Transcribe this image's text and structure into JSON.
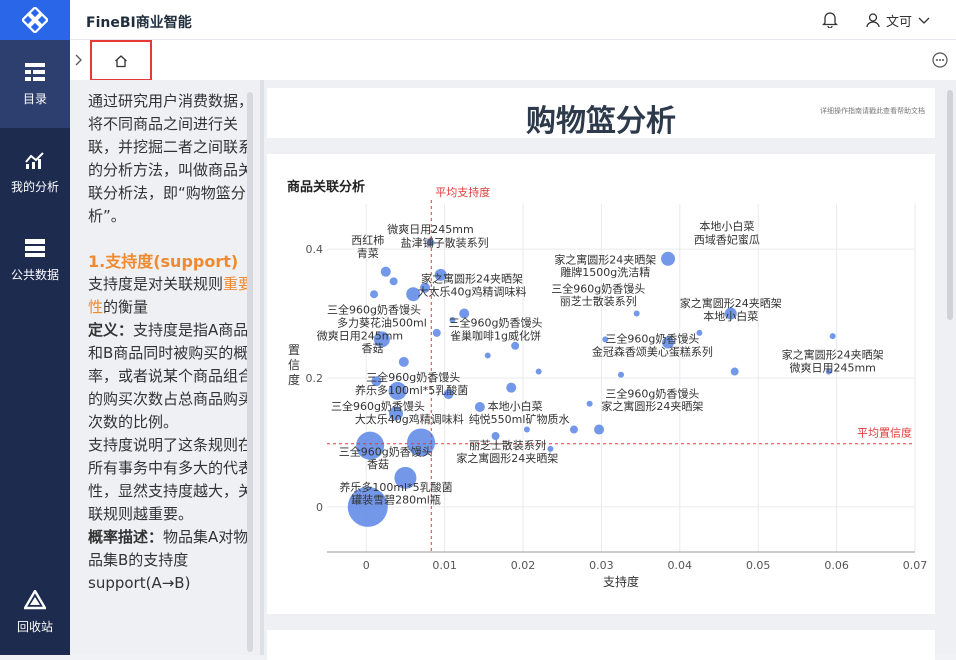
{
  "app": {
    "title": "FineBI商业智能",
    "user_name": "文可"
  },
  "nav": [
    {
      "id": "catalog",
      "label": "目录",
      "icon": "catalog-icon"
    },
    {
      "id": "analysis",
      "label": "我的分析",
      "icon": "analysis-icon"
    },
    {
      "id": "public",
      "label": "公共数据",
      "icon": "database-icon"
    }
  ],
  "nav_bottom": {
    "label": "回收站",
    "icon": "recycle-icon"
  },
  "tabs": {
    "home_icon": "home-icon"
  },
  "left_text": {
    "intro": "通过研究用户消费数据，将不同商品之间进行关联，并挖掘二者之间联系的分析方法，叫做商品关联分析法，即“购物篮分析”。",
    "section_title": "1.支持度(support)",
    "p1_a": "支持度是对关联规则",
    "p1_em": "重要性",
    "p1_b": "的衡量",
    "p2_label": "定义：",
    "p2_text": "支持度是指A商品和B商品同时被购买的概率，或者说某个商品组合的购买次数占总商品购买次数的比例。",
    "p3": "支持度说明了这条规则在所有事务中有多大的代表性，显然支持度越大，关联规则越重要。",
    "p4_label": "概率描述：",
    "p4_text": "物品集A对物品集B的支持度support(A→B)"
  },
  "dashboard": {
    "title": "购物篮分析",
    "help_note": "详细操作指南请戳此查看帮助文档"
  },
  "chart_data": {
    "type": "scatter",
    "title": "商品关联分析",
    "xlabel": "支持度",
    "ylabel": "置信度",
    "xlim": [
      -0.005,
      0.07
    ],
    "ylim": [
      -0.07,
      0.47
    ],
    "x_ticks": [
      "0",
      "0.01",
      "0.02",
      "0.03",
      "0.04",
      "0.05",
      "0.06",
      "0.07"
    ],
    "x_tick_values": [
      0,
      0.01,
      0.02,
      0.03,
      0.04,
      0.05,
      0.06,
      0.07
    ],
    "y_ticks": [
      "0",
      "0.2",
      "0.4"
    ],
    "y_tick_values": [
      0,
      0.2,
      0.4
    ],
    "avg_support": {
      "label": "平均支持度",
      "value": 0.0083
    },
    "avg_confidence": {
      "label": "平均置信度",
      "value": 0.098
    },
    "color": "#5b86e5",
    "line_color": "#e03b3b",
    "points": [
      {
        "x": 0.0002,
        "y": 0.0,
        "r": 20
      },
      {
        "x": 0.0005,
        "y": 0.095,
        "r": 14
      },
      {
        "x": 0.007,
        "y": 0.1,
        "r": 14
      },
      {
        "x": 0.005,
        "y": 0.045,
        "r": 11
      },
      {
        "x": 0.004,
        "y": 0.18,
        "r": 9
      },
      {
        "x": 0.002,
        "y": 0.26,
        "r": 8
      },
      {
        "x": 0.006,
        "y": 0.33,
        "r": 7
      },
      {
        "x": 0.0095,
        "y": 0.36,
        "r": 6
      },
      {
        "x": 0.0038,
        "y": 0.145,
        "r": 7
      },
      {
        "x": 0.0105,
        "y": 0.175,
        "r": 5
      },
      {
        "x": 0.0125,
        "y": 0.3,
        "r": 5
      },
      {
        "x": 0.0145,
        "y": 0.155,
        "r": 5
      },
      {
        "x": 0.0185,
        "y": 0.185,
        "r": 5
      },
      {
        "x": 0.0165,
        "y": 0.11,
        "r": 4
      },
      {
        "x": 0.019,
        "y": 0.25,
        "r": 4
      },
      {
        "x": 0.0025,
        "y": 0.365,
        "r": 5
      },
      {
        "x": 0.001,
        "y": 0.33,
        "r": 4
      },
      {
        "x": 0.0035,
        "y": 0.35,
        "r": 4
      },
      {
        "x": 0.0075,
        "y": 0.34,
        "r": 5
      },
      {
        "x": 0.0048,
        "y": 0.225,
        "r": 5
      },
      {
        "x": 0.009,
        "y": 0.27,
        "r": 4
      },
      {
        "x": 0.011,
        "y": 0.29,
        "r": 3
      },
      {
        "x": 0.0155,
        "y": 0.235,
        "r": 3
      },
      {
        "x": 0.0205,
        "y": 0.12,
        "r": 3
      },
      {
        "x": 0.022,
        "y": 0.21,
        "r": 3
      },
      {
        "x": 0.0265,
        "y": 0.12,
        "r": 4
      },
      {
        "x": 0.0285,
        "y": 0.16,
        "r": 3
      },
      {
        "x": 0.0297,
        "y": 0.12,
        "r": 5
      },
      {
        "x": 0.0305,
        "y": 0.26,
        "r": 3
      },
      {
        "x": 0.0385,
        "y": 0.385,
        "r": 7
      },
      {
        "x": 0.0385,
        "y": 0.255,
        "r": 6
      },
      {
        "x": 0.0465,
        "y": 0.3,
        "r": 6
      },
      {
        "x": 0.047,
        "y": 0.21,
        "r": 4
      },
      {
        "x": 0.0595,
        "y": 0.265,
        "r": 3
      },
      {
        "x": 0.059,
        "y": 0.21,
        "r": 3
      },
      {
        "x": 0.0325,
        "y": 0.205,
        "r": 3
      },
      {
        "x": 0.0425,
        "y": 0.27,
        "r": 3
      },
      {
        "x": 0.0082,
        "y": 0.41,
        "r": 4
      },
      {
        "x": 0.0345,
        "y": 0.3,
        "r": 3
      },
      {
        "x": 0.0235,
        "y": 0.09,
        "r": 3
      },
      {
        "x": 0.0013,
        "y": 0.195,
        "r": 5
      }
    ],
    "annotations": [
      {
        "text": "西红柿",
        "x": 0.0002,
        "y": 0.408
      },
      {
        "text": "青菜",
        "x": 0.0002,
        "y": 0.388
      },
      {
        "text": "微爽日用245mm",
        "x": 0.0082,
        "y": 0.425
      },
      {
        "text": "盐津铺子散装系列",
        "x": 0.01,
        "y": 0.404
      },
      {
        "text": "本地小白菜",
        "x": 0.046,
        "y": 0.43
      },
      {
        "text": "西域香妃蜜瓜",
        "x": 0.046,
        "y": 0.409
      },
      {
        "text": "家之寓圆形24夹晒架",
        "x": 0.0135,
        "y": 0.348
      },
      {
        "text": "大太乐40g鸡精调味料",
        "x": 0.0135,
        "y": 0.328
      },
      {
        "text": "家之寓圆形24夹晒架",
        "x": 0.0305,
        "y": 0.378
      },
      {
        "text": "雕牌1500g洗洁精",
        "x": 0.0305,
        "y": 0.358
      },
      {
        "text": "三全960g奶香馒头",
        "x": 0.0296,
        "y": 0.333
      },
      {
        "text": "丽芝士散装系列",
        "x": 0.0296,
        "y": 0.313
      },
      {
        "text": "三全960g奶香馒头",
        "x": 0.001,
        "y": 0.3
      },
      {
        "text": "多力葵花油500ml",
        "x": 0.002,
        "y": 0.28
      },
      {
        "text": "微爽日用245mm",
        "x": -0.0008,
        "y": 0.26
      },
      {
        "text": "香菇",
        "x": 0.0008,
        "y": 0.24
      },
      {
        "text": "三全960g奶香馒头",
        "x": 0.0165,
        "y": 0.28
      },
      {
        "text": "雀巢咖啡1g威化饼",
        "x": 0.0165,
        "y": 0.26
      },
      {
        "text": "家之寓圆形24夹晒架",
        "x": 0.0465,
        "y": 0.31
      },
      {
        "text": "本地小白菜",
        "x": 0.0465,
        "y": 0.29
      },
      {
        "text": "三全960g奶香馒头",
        "x": 0.0365,
        "y": 0.255
      },
      {
        "text": "金冠森香颂美心蛋糕系列",
        "x": 0.0365,
        "y": 0.235
      },
      {
        "text": "家之寓圆形24夹晒架",
        "x": 0.0595,
        "y": 0.23
      },
      {
        "text": "微爽日用245mm",
        "x": 0.0595,
        "y": 0.21
      },
      {
        "text": "三全960g奶香馒头",
        "x": 0.006,
        "y": 0.195
      },
      {
        "text": "养乐多100ml*5乳酸菌",
        "x": 0.0058,
        "y": 0.175
      },
      {
        "text": "三全960g奶香馒头",
        "x": 0.0365,
        "y": 0.17
      },
      {
        "text": "家之寓圆形24夹晒架",
        "x": 0.0365,
        "y": 0.15
      },
      {
        "text": "三全960g奶香馒头",
        "x": 0.0015,
        "y": 0.15
      },
      {
        "text": "本地小白菜",
        "x": 0.019,
        "y": 0.15
      },
      {
        "text": "大太乐40g鸡精调味料",
        "x": 0.0055,
        "y": 0.13
      },
      {
        "text": "纯悦550ml矿物质水",
        "x": 0.0195,
        "y": 0.13
      },
      {
        "text": "丽芝士散装系列",
        "x": 0.018,
        "y": 0.09
      },
      {
        "text": "三全960g奶香馒头",
        "x": 0.0025,
        "y": 0.08
      },
      {
        "text": "家之寓圆形24夹晒架",
        "x": 0.018,
        "y": 0.07
      },
      {
        "text": "香菇",
        "x": 0.0015,
        "y": 0.06
      },
      {
        "text": "养乐多100ml*5乳酸菌",
        "x": 0.0038,
        "y": 0.025
      },
      {
        "text": "罐装雪碧280ml瓶",
        "x": 0.0038,
        "y": 0.005
      }
    ]
  }
}
